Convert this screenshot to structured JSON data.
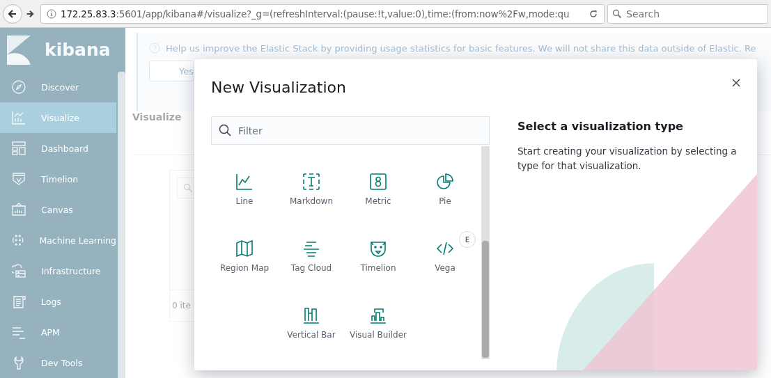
{
  "browser": {
    "url_host": "172.25.83.3",
    "url_rest": ":5601/app/kibana#/visualize?_g=(refreshInterval:(pause:!t,value:0),time:(from:now%2Fw,mode:qu",
    "search_placeholder": "Search"
  },
  "sidebar": {
    "logo": "kibana",
    "items": [
      {
        "label": "Discover",
        "selected": false
      },
      {
        "label": "Visualize",
        "selected": true
      },
      {
        "label": "Dashboard",
        "selected": false
      },
      {
        "label": "Timelion",
        "selected": false
      },
      {
        "label": "Canvas",
        "selected": false
      },
      {
        "label": "Machine Learning",
        "selected": false
      },
      {
        "label": "Infrastructure",
        "selected": false
      },
      {
        "label": "Logs",
        "selected": false
      },
      {
        "label": "APM",
        "selected": false
      },
      {
        "label": "Dev Tools",
        "selected": false
      }
    ]
  },
  "background": {
    "banner": "Help us improve the Elastic Stack by providing usage statistics for basic features. We will not share this data outside of Elastic. Re",
    "button": "Yes",
    "heading": "Visualize",
    "footer": "0 ite"
  },
  "modal": {
    "title": "New Visualization",
    "filter_placeholder": "Filter",
    "types": [
      {
        "label": "Line"
      },
      {
        "label": "Markdown"
      },
      {
        "label": "Metric"
      },
      {
        "label": "Pie"
      },
      {
        "label": "Region Map"
      },
      {
        "label": "Tag Cloud"
      },
      {
        "label": "Timelion"
      },
      {
        "label": "Vega",
        "badge": "E"
      },
      {
        "label": "Vertical Bar"
      },
      {
        "label": "Visual Builder"
      }
    ],
    "panel_title": "Select a visualization type",
    "panel_text": "Start creating your visualization by selecting a type for that visualization."
  }
}
